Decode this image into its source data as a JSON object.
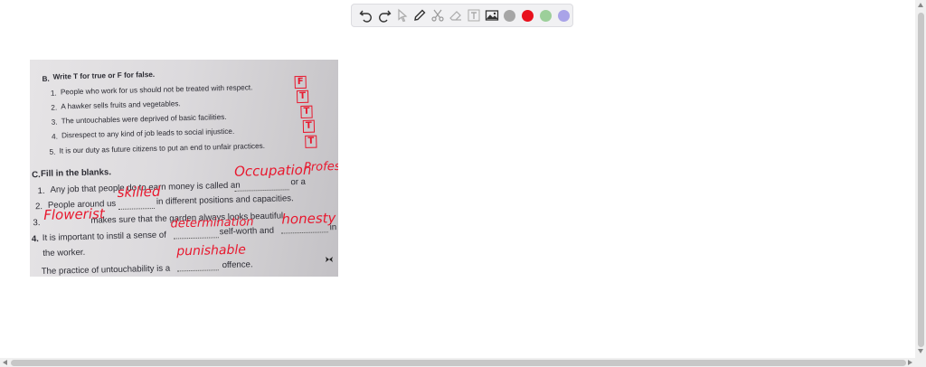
{
  "toolbar": {
    "tools": [
      "undo-icon",
      "redo-icon",
      "pointer-icon",
      "pen-icon",
      "scissors-icon",
      "eraser-icon",
      "text-icon",
      "image-icon"
    ],
    "colors": [
      "#a6a6a6",
      "#e8111d",
      "#9ccf9a",
      "#a9a3e8"
    ]
  },
  "worksheet": {
    "section_b_heading": "Write T for true or F for false.",
    "section_b_number": "B.",
    "true_false": [
      {
        "num": "1.",
        "text": "People who work for us should not be treated with respect.",
        "answer": "F"
      },
      {
        "num": "2.",
        "text": "A hawker sells fruits and vegetables.",
        "answer": "T"
      },
      {
        "num": "3.",
        "text": "The untouchables were deprived of basic facilities.",
        "answer": "T"
      },
      {
        "num": "4.",
        "text": "Disrespect to any kind of job leads to social injustice.",
        "answer": "T"
      },
      {
        "num": "5.",
        "text": "It is our duty as future citizens to put an end to unfair practices.",
        "answer": "T"
      }
    ],
    "section_c_number": "C.",
    "section_c_heading": "Fill in the blanks.",
    "blanks": {
      "q1_num": "1.",
      "q1_a": "Any job that people do to earn money is called an",
      "q1_b": "or a",
      "q1_ans1": "Occupation",
      "q1_ans2": "Profession",
      "q2_num": "2.",
      "q2_a": "People around us",
      "q2_b": "in different positions and capacities.",
      "q2_ans": "skilled",
      "q3_num": "3.",
      "q3_b": "makes sure that the garden always looks beautiful.",
      "q3_ans": "Flowerist",
      "q4_num": "4.",
      "q4_a": "It is important to instil a sense of",
      "q4_b": "self-worth and",
      "q4_c": "in",
      "q4_d": "the worker.",
      "q4_ans1": "determination",
      "q4_ans2": "honesty",
      "q5_a": "The practice of untouchability is a",
      "q5_b": "offence.",
      "q5_ans": "punishable"
    }
  }
}
